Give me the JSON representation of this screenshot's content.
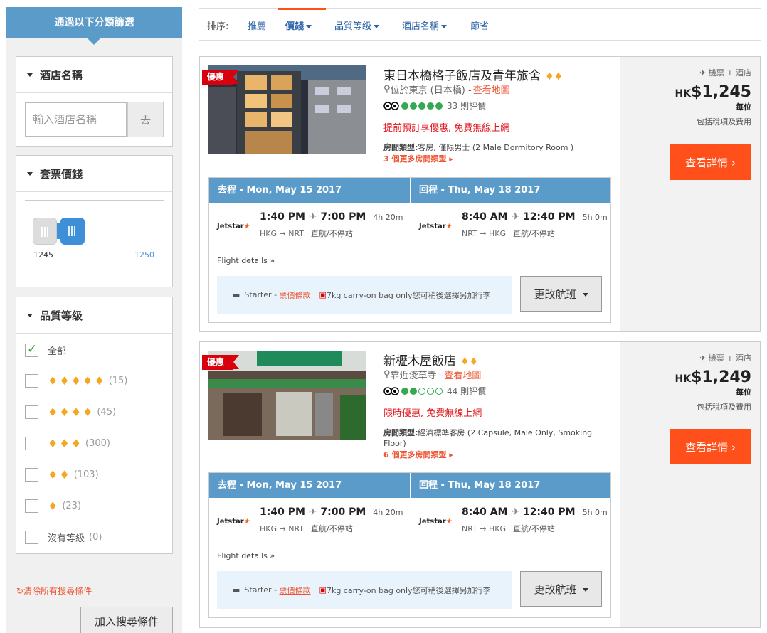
{
  "sidebar": {
    "header": "通過以下分類篩選",
    "hotel_name_title": "酒店名稱",
    "search_placeholder": "輸入酒店名稱",
    "search_go": "去",
    "price_title": "套票價錢",
    "price_min": "1245",
    "price_max": "1250",
    "quality_title": "品質等级",
    "quality_options": [
      {
        "label": "全部",
        "diamonds": "",
        "count": "",
        "checked": true
      },
      {
        "label": "",
        "diamonds": "♦♦♦♦♦",
        "count": "(15)",
        "checked": false
      },
      {
        "label": "",
        "diamonds": "♦♦♦♦",
        "count": "(45)",
        "checked": false
      },
      {
        "label": "",
        "diamonds": "♦♦♦",
        "count": "(300)",
        "checked": false
      },
      {
        "label": "",
        "diamonds": "♦♦",
        "count": "(103)",
        "checked": false
      },
      {
        "label": "",
        "diamonds": "♦",
        "count": "(23)",
        "checked": false
      },
      {
        "label": "沒有等級",
        "diamonds": "",
        "count": "(0)",
        "checked": false
      }
    ],
    "clear_filters": "清除所有搜尋條件",
    "add_criteria": "加入搜尋條件"
  },
  "sortbar": {
    "label": "排序:",
    "items": [
      "推薦",
      "價錢",
      "品質等级",
      "酒店名稱",
      "節省"
    ]
  },
  "hotels": [
    {
      "deal": "優惠",
      "name": "東日本橋格子飯店及青年旅舍",
      "diamonds": "♦♦",
      "location": "位於東京 (日本橋) -",
      "map_link": "查看地圖",
      "reviews": "33 則評價",
      "promo": "提前預訂享優惠, 免費無線上網",
      "room_label": "房間類型:",
      "room_type": "客房, 僅限男士 (2 Male Dormitory Room )",
      "more_rooms": "3 個更多房間類型 ▸",
      "pkg": "機票 + 酒店",
      "currency": "HK",
      "price": "$1,245",
      "per": "每位",
      "incl": "包括稅項及費用",
      "view": "查看詳情"
    },
    {
      "deal": "優惠",
      "name": "新櫪木屋飯店",
      "diamonds": "♦♦",
      "location": "靠近淺草寺 -",
      "map_link": "查看地圖",
      "reviews": "44 則評價",
      "promo": "限時優惠, 免費無線上網",
      "room_label": "房間類型:",
      "room_type": "經濟標準客房 (2 Capsule, Male Only, Smoking Floor)",
      "more_rooms": "6 個更多房間類型 ▸",
      "pkg": "機票 + 酒店",
      "currency": "HK",
      "price": "$1,249",
      "per": "每位",
      "incl": "包括稅項及費用",
      "view": "查看詳情"
    }
  ],
  "flight": {
    "outbound_head": "去程 - Mon, May 15 2017",
    "return_head": "回程 - Thu, May 18 2017",
    "airline": "Jetstar",
    "out_depart": "1:40 PM",
    "out_arrive": "7:00 PM",
    "out_duration": "4h 20m",
    "out_route": "HKG → NRT",
    "out_stops": "直航/不停站",
    "ret_depart": "8:40 AM",
    "ret_arrive": "12:40 PM",
    "ret_duration": "5h 0m",
    "ret_route": "NRT → HKG",
    "ret_stops": "直航/不停站",
    "details": "Flight details »",
    "fare_prefix": "Starter -",
    "fare_rule": "票價條款",
    "fare_bag": "7kg carry-on bag only您可稍後選擇另加行李",
    "change": "更改航班"
  },
  "colors": {
    "accent": "#ff4f1b",
    "header_blue": "#5b9bc9",
    "diamond": "#f5a623",
    "deal_red": "#d9000d"
  }
}
